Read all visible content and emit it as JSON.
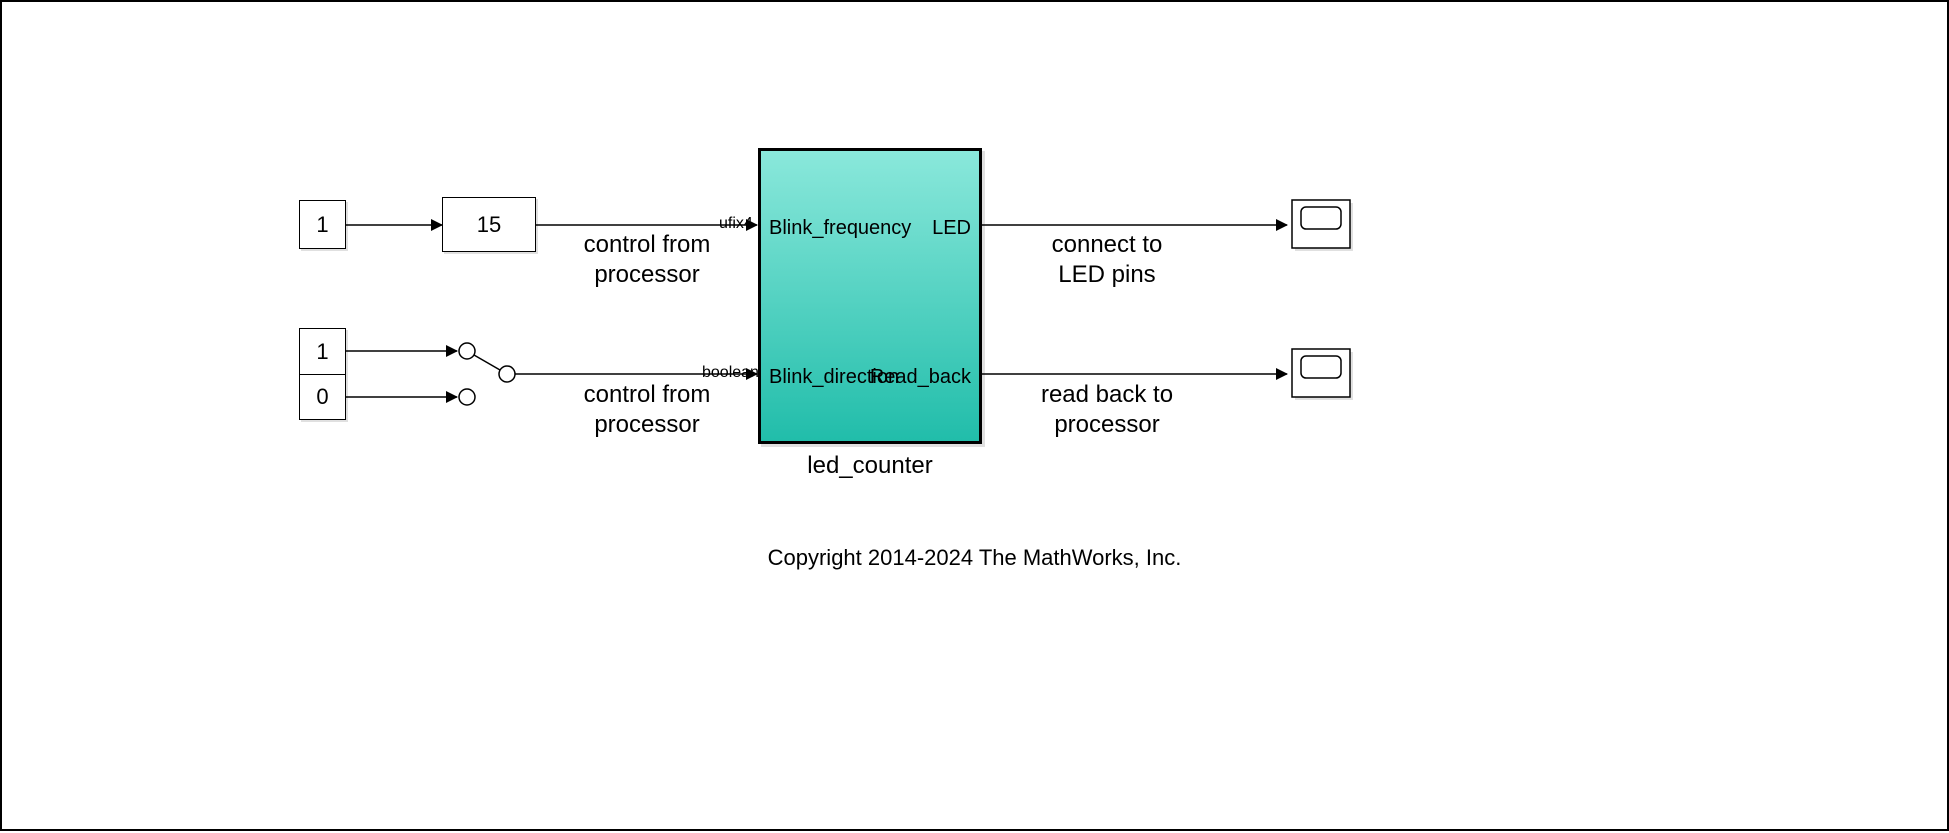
{
  "blocks": {
    "const_top": "1",
    "slider_gain": "15",
    "const_one": "1",
    "const_zero": "0"
  },
  "subsystem": {
    "name": "led_counter",
    "port_in1": "Blink_frequency",
    "port_in2": "Blink_direction",
    "port_out1": "LED",
    "port_out2": "Read_back"
  },
  "types": {
    "in1": "ufix4",
    "in2": "boolean"
  },
  "annotations": {
    "ctrl1_line1": "control from",
    "ctrl1_line2": "processor",
    "ctrl2_line1": "control from",
    "ctrl2_line2": "processor",
    "out1_line1": "connect to",
    "out1_line2": "LED pins",
    "out2_line1": "read back to",
    "out2_line2": "processor"
  },
  "copyright": "Copyright 2014-2024 The MathWorks, Inc."
}
